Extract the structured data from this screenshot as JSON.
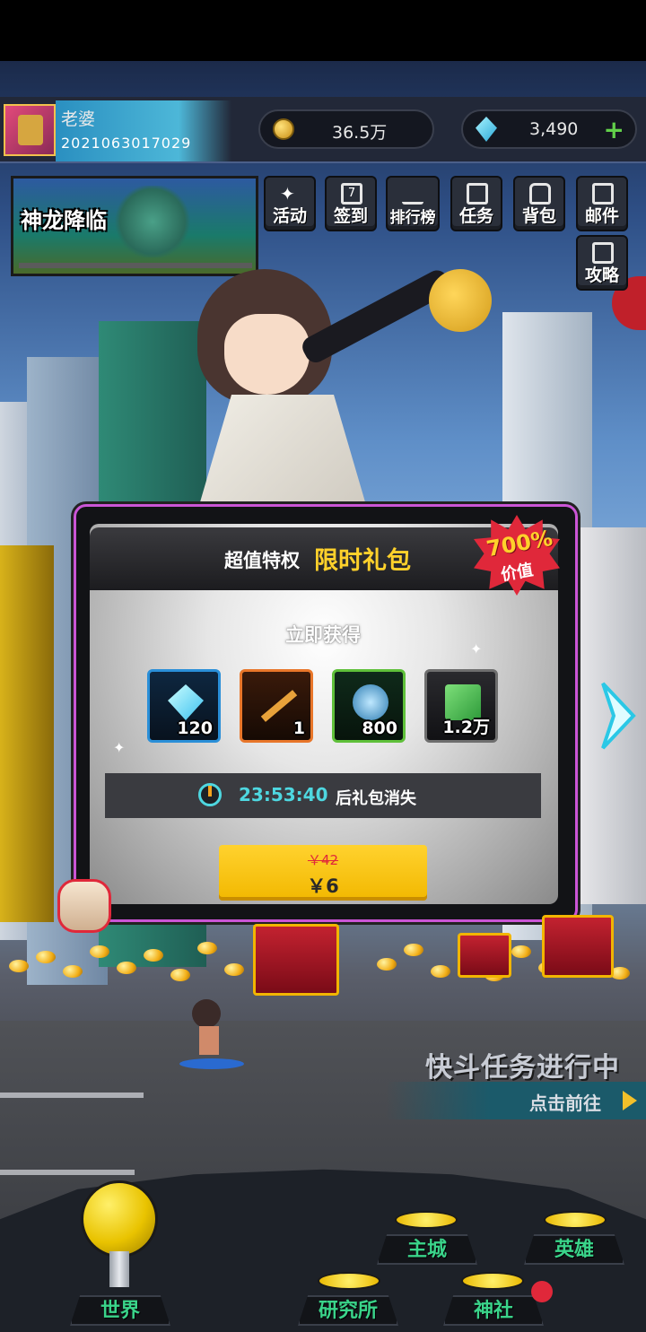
{
  "player": {
    "name": "老婆",
    "id": "2021063017029"
  },
  "currencies": {
    "gold": "36.5万",
    "gems": "3,490",
    "gems_add": "+"
  },
  "event_banner": {
    "title": "神龙降临"
  },
  "top_menu": [
    {
      "label": "活动",
      "icon": "sparkle-icon"
    },
    {
      "label": "签到",
      "icon": "calendar-icon",
      "badge": "7"
    },
    {
      "label": "排行榜",
      "icon": "ranking-icon"
    },
    {
      "label": "任务",
      "icon": "task-icon"
    },
    {
      "label": "背包",
      "icon": "bag-icon"
    },
    {
      "label": "邮件",
      "icon": "mail-icon"
    },
    {
      "label": "攻略",
      "icon": "guide-book-icon"
    }
  ],
  "gift_popup": {
    "title_prefix": "超值特权",
    "title_highlight": "限时礼包",
    "value_badge": {
      "percent": "700%",
      "label": "价值"
    },
    "subtitle": "立即获得",
    "items": [
      {
        "icon": "gem-icon",
        "count": "120",
        "border": "#2a8fd8"
      },
      {
        "icon": "sword-icon",
        "count": "1",
        "border": "#e8762a"
      },
      {
        "icon": "armor-icon",
        "count": "800",
        "border": "#5fc03a"
      },
      {
        "icon": "cash-stack-icon",
        "count": "1.2万",
        "border": "#6e6e6e"
      }
    ],
    "timer": {
      "value": "23:53:40",
      "suffix": "后礼包消失"
    },
    "price": {
      "original": "￥42",
      "current": "￥6"
    }
  },
  "quest": {
    "title": "快斗任务进行中",
    "action": "点击前往"
  },
  "bottom_nav": [
    {
      "label": "世界"
    },
    {
      "label": "研究所"
    },
    {
      "label": "神社"
    },
    {
      "label": "主城"
    },
    {
      "label": "英雄"
    }
  ],
  "colors": {
    "popup_border": "#cb55d6",
    "highlight_gold": "#ffd12b",
    "timer_cyan": "#4ed7e0",
    "buy_button": "#ffd22e",
    "nav_green": "#3ad48a"
  }
}
